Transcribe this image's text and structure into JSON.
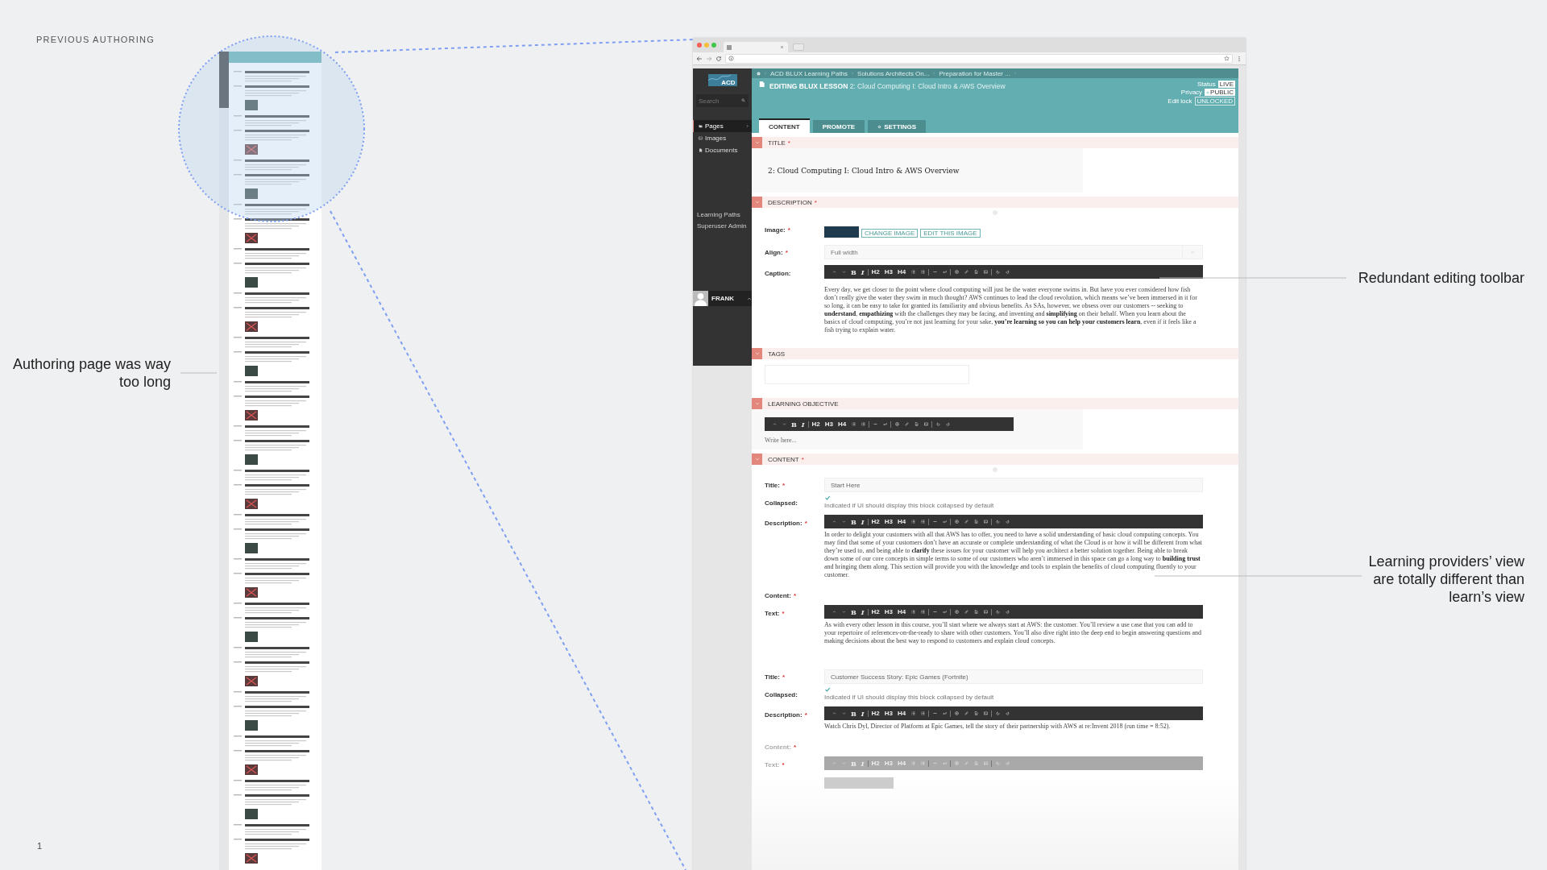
{
  "slide": {
    "heading": "PREVIOUS AUTHORING",
    "page_number": "1"
  },
  "annotations": [
    {
      "text": "Authoring page was way too long"
    },
    {
      "text": "Redundant editing toolbar"
    },
    {
      "text": "Learning providers’ view are totally different than learn’s view"
    }
  ],
  "app": {
    "logo": "ACD",
    "search": {
      "placeholder": "Search"
    },
    "nav": [
      {
        "label": "Pages",
        "selected": true
      },
      {
        "label": "Images",
        "selected": false
      },
      {
        "label": "Documents",
        "selected": false
      }
    ],
    "secondary_nav": [
      {
        "label": "Learning Paths"
      },
      {
        "label": "Superuser Admin"
      }
    ],
    "user": {
      "name": "FRANK"
    },
    "breadcrumbs": [
      "ACD BLUX Learning Paths",
      "Solutions Architects On...",
      "Preparation for Master ..."
    ],
    "page_title": "**EDITING BLUX LESSON** 2: Cloud Computing I: Cloud Intro & AWS Overview",
    "meta": [
      {
        "kind": "status",
        "label": "Status",
        "value": "LIVE"
      },
      {
        "kind": "privacy",
        "label": "Privacy",
        "value": "PUBLIC"
      },
      {
        "kind": "lock",
        "label": "Edit lock",
        "value": "UNLOCKED"
      }
    ],
    "tabs": [
      {
        "kind": "plain",
        "label": "CONTENT",
        "selected": true
      },
      {
        "kind": "plain",
        "label": "PROMOTE",
        "selected": false
      },
      {
        "kind": "settings",
        "label": "SETTINGS",
        "selected": false
      }
    ],
    "sections": [
      {
        "label": "TITLE",
        "required_mark": "*",
        "add_block": false,
        "fields": [
          {
            "kind": "heading",
            "value": "2: Cloud Computing I: Cloud Intro & AWS Overview"
          }
        ]
      },
      {
        "label": "DESCRIPTION",
        "required_mark": "*",
        "add_block": true,
        "fields": [
          {
            "kind": "image",
            "label": "Image:",
            "required_mark": "*",
            "buttons": [
              "CHANGE IMAGE",
              "EDIT THIS IMAGE"
            ]
          },
          {
            "kind": "select",
            "label": "Align:",
            "required_mark": "*",
            "value": "Full width"
          },
          {
            "kind": "editor",
            "label": "Caption:",
            "faded": false,
            "buttons": [
              "B",
              "I",
              "H2",
              "H3",
              "H4"
            ],
            "text": "Every day, we get closer to the point where cloud computing will just be the water everyone swims in. But have you ever considered how fish don’t really give the water they swim in much thought? AWS continues to lead the cloud revolution, which means we’ve been immersed in it for so long, it can be easy to take for granted its familiarity and obvious benefits. As SAs, however, we obsess over our customers -- seeking to **understand**, **empathizing** with the challenges they may be facing, and inventing and **simplifying** on their behalf. When you learn about the basics of cloud computing, you’re not just learning for your sake, **you’re learning so you can help your customers learn**, even if it feels like a fish trying to explain water."
          }
        ]
      },
      {
        "label": "TAGS",
        "add_block": false,
        "fields": [
          {
            "kind": "tags"
          }
        ]
      },
      {
        "label": "LEARNING OBJECTIVE",
        "add_block": false,
        "fields": [
          {
            "kind": "objective",
            "buttons": [
              "B",
              "I",
              "H2",
              "H3",
              "H4"
            ],
            "placeholder": "Write here..."
          }
        ]
      },
      {
        "label": "CONTENT",
        "required_mark": "*",
        "add_block": true,
        "fields": [
          {
            "kind": "input",
            "label": "Title:",
            "required_mark": "*",
            "value": "Start Here"
          },
          {
            "kind": "checkbox",
            "label": "Collapsed:",
            "checked": true,
            "hint": "Indicated if UI should display this block collapsed by default"
          },
          {
            "kind": "editor",
            "label": "Description:",
            "required_mark": "*",
            "faded": false,
            "buttons": [
              "B",
              "I",
              "H2",
              "H3",
              "H4"
            ],
            "text": "In order to delight your customers with all that AWS has to offer, you need to have a solid understanding of basic cloud computing concepts. You may find that some of your customers don’t have an accurate or complete understanding of what the Cloud is or how it will be different from what they’re used to, and being able to **clarify** these issues for your customer will help you architect a better solution together. Being able to break down some of our core concepts in simple terms to some of our customers who aren’t immersed in this space can go a long way to **building trust** and bringing them along. This section will provide you with the knowledge and tools to explain the benefits of cloud computing fluently to your customer."
          },
          {
            "kind": "label",
            "label": "Content:",
            "required_mark": "*",
            "faded": false
          },
          {
            "kind": "editor",
            "label": "Text:",
            "required_mark": "*",
            "faded": false,
            "buttons": [
              "B",
              "I",
              "H2",
              "H3",
              "H4"
            ],
            "text": "As with every other lesson in this course, you’ll start where we always start at AWS: the customer. You’ll review a use case that you can add to your repertoire of references-on-the-ready to share with other customers. You’ll also dive right into the deep end to begin answering questions and making decisions about the best way to respond to customers and explain cloud concepts."
          },
          {
            "kind": "input",
            "label": "Title:",
            "required_mark": "*",
            "value": "Customer Success Story: Epic Games (Fortnite)"
          },
          {
            "kind": "checkbox",
            "label": "Collapsed:",
            "checked": true,
            "hint": "Indicated if UI should display this block collapsed by default"
          },
          {
            "kind": "editor",
            "label": "Description:",
            "required_mark": "*",
            "faded": false,
            "buttons": [
              "B",
              "I",
              "H2",
              "H3",
              "H4"
            ],
            "text": "Watch Chris Dyl, Director of Platform at Epic Games, tell the story of their partnership with AWS at re:Invent 2018 (run time = 8:52)."
          },
          {
            "kind": "label",
            "label": "Content:",
            "required_mark": "*",
            "faded": true
          },
          {
            "kind": "editor",
            "label": "Text:",
            "required_mark": "*",
            "faded": true,
            "buttons": [
              "B",
              "I",
              "H2",
              "H3",
              "H4"
            ]
          },
          {
            "kind": "media"
          }
        ]
      }
    ]
  }
}
